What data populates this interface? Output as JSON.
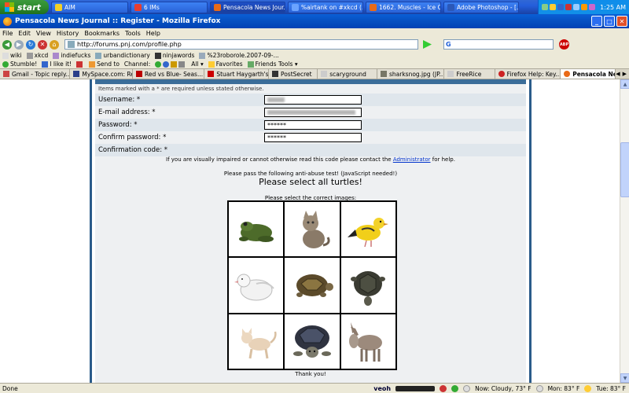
{
  "taskbar": {
    "start_label": "start",
    "tasks": [
      {
        "label": "AIM",
        "color": "#f3d026"
      },
      {
        "label": "6 IMs",
        "color": "#e83d2f"
      },
      {
        "label": "Pensacola News Jour...",
        "color": "#e96a18"
      },
      {
        "label": "%airtank on #xkcd (...",
        "color": "#6aa3ff"
      },
      {
        "label": "1662. Muscles - Ice C...",
        "color": "#e96a18"
      },
      {
        "label": "Adobe Photoshop - [...",
        "color": "#2b58b8"
      }
    ],
    "clock": "1:25 AM"
  },
  "window": {
    "title": "Pensacola News Journal :: Register - Mozilla Firefox"
  },
  "menu": [
    "File",
    "Edit",
    "View",
    "History",
    "Bookmarks",
    "Tools",
    "Help"
  ],
  "nav": {
    "url": "http://forums.pnj.com/profile.php",
    "search_placeholder": ""
  },
  "bookmarks": [
    "wiki",
    "xkcd",
    "indiefucks",
    "urbandictionary",
    "ninjawords",
    "%23roborole.2007-09-..."
  ],
  "toolbar2": {
    "stumble": "Stumble!",
    "like": "I like it!",
    "send": "Send to",
    "channel": "Channel:",
    "all": "All",
    "favorites": "Favorites",
    "friends": "Friends Tools"
  },
  "tabs": [
    {
      "label": "Gmail - Topic reply...",
      "color": "#c44"
    },
    {
      "label": "MySpace.com: Re...",
      "color": "#2b3f8a"
    },
    {
      "label": "Red vs Blue- Seas...",
      "color": "#b00"
    },
    {
      "label": "Stuart Haygarth's...",
      "color": "#c00"
    },
    {
      "label": "PostSecret",
      "color": "#333"
    },
    {
      "label": "scaryground",
      "color": "#ccc"
    },
    {
      "label": "sharksnog.jpg (JP...",
      "color": "#776"
    },
    {
      "label": "FreeRice",
      "color": "#ccc"
    },
    {
      "label": "Firefox Help: Key...",
      "color": "#c22"
    },
    {
      "label": "Pensacola New...",
      "color": "#e96a18"
    }
  ],
  "form": {
    "note": "Items marked with a * are required unless stated otherwise.",
    "username_label": "Username: *",
    "email_label": "E-mail address: *",
    "password_label": "Password: *",
    "password_value": "******",
    "confirm_label": "Confirm password: *",
    "confirm_value": "******",
    "code_label": "Confirmation code: *",
    "impaired_pre": "If you are visually impaired or cannot otherwise read this code please contact the",
    "impaired_link": "Administrator",
    "impaired_post": "for help.",
    "test_line": "Please pass the following anti-abuse test! (JavaScript needed!)",
    "instruction": "Please select all turtles!",
    "select_prompt": "Please select the correct images:",
    "thanks": "Thank you!"
  },
  "captcha_images": [
    {
      "name": "frog",
      "is_turtle": false
    },
    {
      "name": "cat",
      "is_turtle": false
    },
    {
      "name": "canary",
      "is_turtle": false
    },
    {
      "name": "dove",
      "is_turtle": false
    },
    {
      "name": "tortoise",
      "is_turtle": true
    },
    {
      "name": "turtle",
      "is_turtle": true
    },
    {
      "name": "kitten",
      "is_turtle": false
    },
    {
      "name": "turtle",
      "is_turtle": true
    },
    {
      "name": "donkey",
      "is_turtle": false
    }
  ],
  "status": {
    "left": "Done",
    "veoh": "veoh",
    "weather_now": "Now: Cloudy, 73° F",
    "weather_mon": "Mon: 83° F",
    "weather_tue": "Tue: 83° F"
  }
}
